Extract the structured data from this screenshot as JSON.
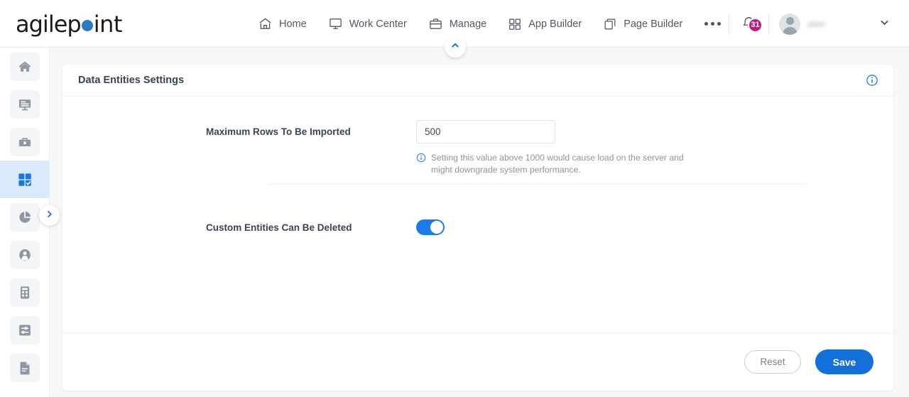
{
  "brand": {
    "name_part1": "agilep",
    "name_dot": "o",
    "name_part2": "int",
    "dot_color": "#2a7ac4"
  },
  "header": {
    "nav": [
      {
        "label": "Home",
        "icon": "home-icon"
      },
      {
        "label": "Work Center",
        "icon": "monitor-icon"
      },
      {
        "label": "Manage",
        "icon": "briefcase-icon"
      },
      {
        "label": "App Builder",
        "icon": "grid-icon"
      },
      {
        "label": "Page Builder",
        "icon": "pages-icon"
      }
    ],
    "more_icon": "ellipsis-icon",
    "notifications": {
      "icon": "bell-icon",
      "count": "31",
      "badge_color": "#bf1a7e"
    },
    "user": {
      "avatar_icon": "avatar-icon",
      "name": "",
      "caret_icon": "chevron-down-icon"
    },
    "collapse_icon": "chevron-up-icon"
  },
  "sidebar": {
    "items": [
      {
        "name": "home",
        "icon": "home-icon",
        "active": false
      },
      {
        "name": "work-center",
        "icon": "monitor-icon",
        "active": false
      },
      {
        "name": "manage",
        "icon": "briefcase-icon",
        "active": false
      },
      {
        "name": "app-builder",
        "icon": "grid-check-icon",
        "active": true
      },
      {
        "name": "reports",
        "icon": "pie-chart-icon",
        "active": false
      },
      {
        "name": "users",
        "icon": "user-icon",
        "active": false
      },
      {
        "name": "calculator",
        "icon": "calculator-icon",
        "active": false
      },
      {
        "name": "settings",
        "icon": "sliders-icon",
        "active": false
      },
      {
        "name": "documents",
        "icon": "document-icon",
        "active": false
      }
    ],
    "expand_icon": "chevron-right-icon",
    "active_bg": "#dbeafb"
  },
  "card": {
    "title": "Data Entities Settings",
    "info_icon": "info-circle-icon",
    "fields": [
      {
        "label": "Maximum Rows To Be Imported",
        "type": "text",
        "value": "500",
        "placeholder": "",
        "hint_icon": "info-circle-icon",
        "hint": "Setting this value above 1000 would cause load on the server and might downgrade system performance."
      },
      {
        "label": "Custom Entities Can Be Deleted",
        "type": "toggle",
        "value": "on",
        "toggle_color": "#1a7ce8"
      }
    ],
    "footer": {
      "reset_label": "Reset",
      "save_label": "Save",
      "save_color": "#1370d8"
    }
  }
}
